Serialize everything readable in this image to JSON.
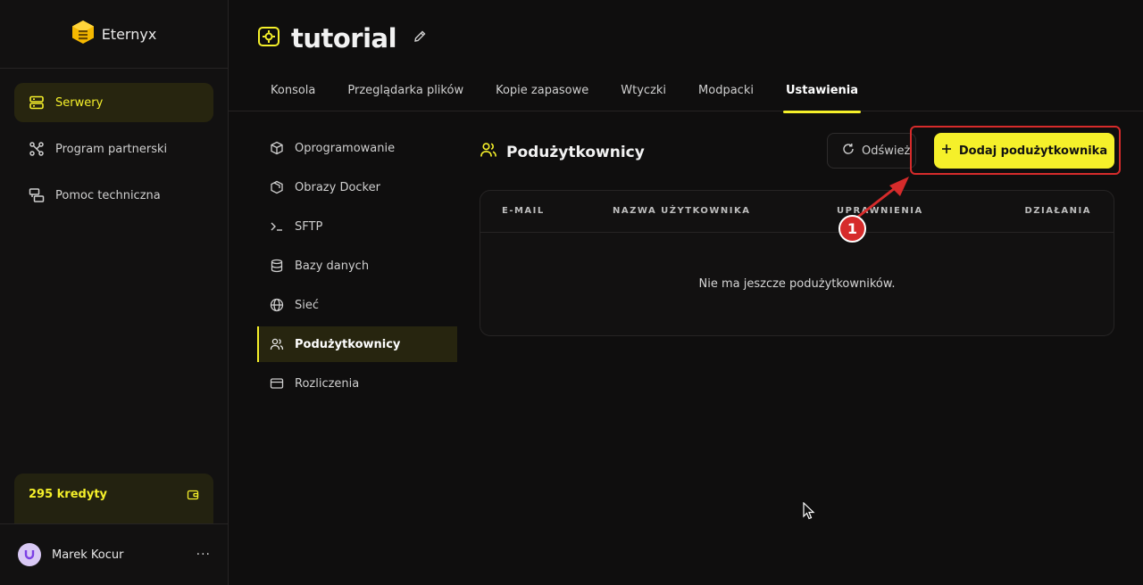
{
  "brand": {
    "name": "Eternyx"
  },
  "sidebar": {
    "items": [
      {
        "label": "Serwery",
        "icon": "server-icon",
        "active": true
      },
      {
        "label": "Program partnerski",
        "icon": "network-icon",
        "active": false
      },
      {
        "label": "Pomoc techniczna",
        "icon": "support-chat-icon",
        "active": false
      }
    ],
    "credits": {
      "label": "295 kredyty",
      "icon": "wallet-icon"
    },
    "user": {
      "name": "Marek Kocur",
      "menu": "···"
    }
  },
  "header": {
    "title": "tutorial",
    "tabs": [
      {
        "label": "Konsola"
      },
      {
        "label": "Przeglądarka plików"
      },
      {
        "label": "Kopie zapasowe"
      },
      {
        "label": "Wtyczki"
      },
      {
        "label": "Modpacki"
      },
      {
        "label": "Ustawienia",
        "active": true
      }
    ]
  },
  "submenu": {
    "items": [
      {
        "label": "Oprogramowanie",
        "icon": "box-icon"
      },
      {
        "label": "Obrazy Docker",
        "icon": "docker-box-icon"
      },
      {
        "label": "SFTP",
        "icon": "terminal-icon"
      },
      {
        "label": "Bazy danych",
        "icon": "database-icon"
      },
      {
        "label": "Sieć",
        "icon": "globe-icon"
      },
      {
        "label": "Podużytkownicy",
        "icon": "users-icon",
        "active": true
      },
      {
        "label": "Rozliczenia",
        "icon": "credit-card-icon"
      }
    ]
  },
  "main": {
    "section_title": "Podużytkownicy",
    "refresh_label": "Odśwież",
    "add_label": "Dodaj podużytkownika",
    "table": {
      "columns": [
        "E-MAIL",
        "NAZWA UŻYTKOWNIKA",
        "UPRAWNIENIA",
        "DZIAŁANIA"
      ],
      "empty_message": "Nie ma jeszcze podużytkowników."
    },
    "annotation_number": "1"
  },
  "colors": {
    "accent": "#f5f02a",
    "annotation": "#d62b2b",
    "background": "#0f0e0e"
  }
}
